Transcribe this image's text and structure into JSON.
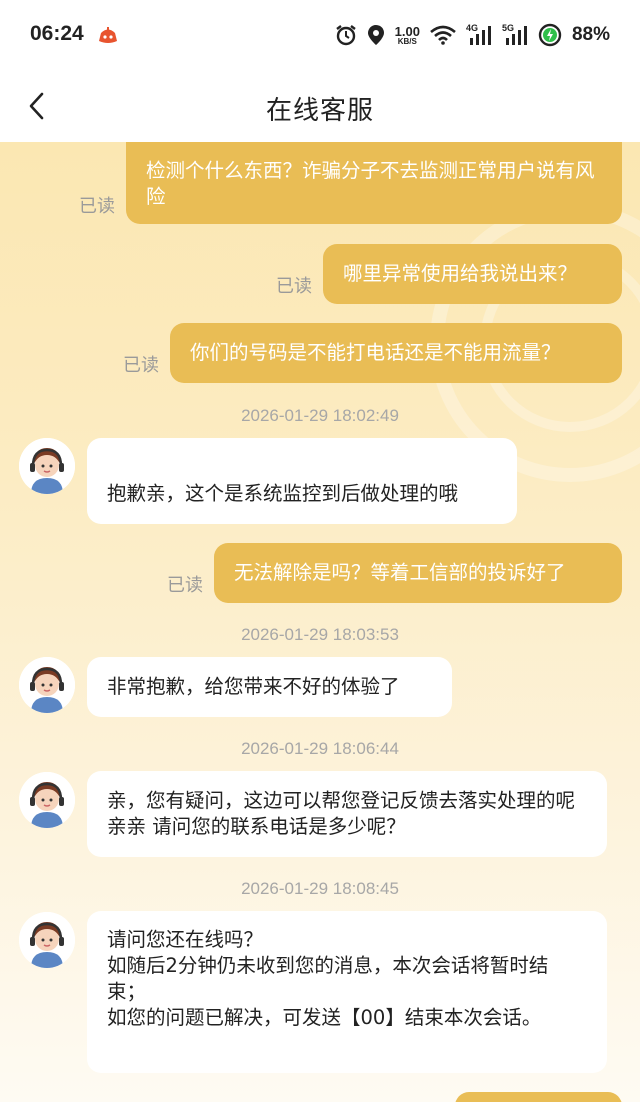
{
  "status_bar": {
    "time": "06:24",
    "net_speed_value": "1.00",
    "net_speed_unit": "KB/S",
    "signal_1": "4G",
    "signal_2": "5G",
    "battery": "88%"
  },
  "header": {
    "title": "在线客服"
  },
  "read_label": "已读",
  "messages": [
    {
      "side": "out",
      "text": "检测个什么东西？诈骗分子不去监测正常用户说有风险",
      "read": "已读"
    },
    {
      "side": "out",
      "text": "哪里异常使用给我说出来？",
      "read": "已读"
    },
    {
      "side": "out",
      "text": "你们的号码是不能打电话还是不能用流量？",
      "read": "已读"
    },
    {
      "side": "time",
      "text": "2026-01-29 18:02:49"
    },
    {
      "side": "in",
      "text": "抱歉亲，这个是系统监控到后做处理的哦"
    },
    {
      "side": "out",
      "text": "无法解除是吗？等着工信部的投诉好了",
      "read": "已读"
    },
    {
      "side": "time",
      "text": "2026-01-29 18:03:53"
    },
    {
      "side": "in",
      "text": "非常抱歉，给您带来不好的体验了"
    },
    {
      "side": "time",
      "text": "2026-01-29 18:06:44"
    },
    {
      "side": "in",
      "text": "亲，您有疑问，这边可以帮您登记反馈去落实处理的呢亲亲 请问您的联系电话是多少呢？"
    },
    {
      "side": "time",
      "text": "2026-01-29 18:08:45"
    },
    {
      "side": "in",
      "text": "请问您还在线吗？\n如随后2分钟仍未收到您的消息，本次会话将暂时结束；\n如您的问题已解决，可发送【00】结束本次会话。"
    }
  ]
}
